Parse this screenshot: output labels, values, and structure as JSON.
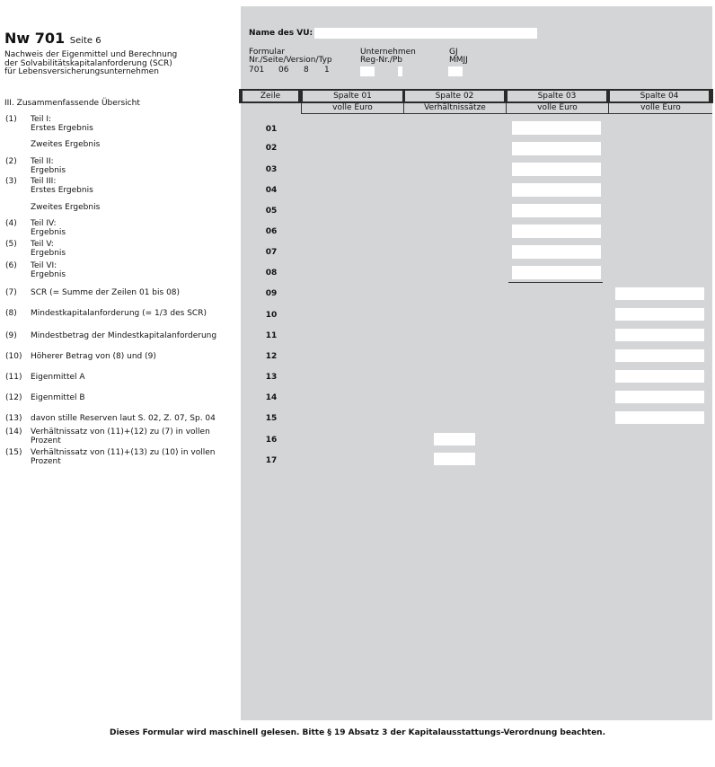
{
  "form_title": "Nw 701",
  "form_title_suffix": "Seite 6",
  "subtitle_lines": [
    "Nachweis der Eigenmittel und Berechnung",
    "der Solvabilitätskapitalanforderung (SCR)",
    "für Lebensversicherungsunternehmen"
  ],
  "section_title": "III. Zusammenfassende Übersicht",
  "name_vu_label": "Name des VU:",
  "meta": {
    "formular_label": "Formular",
    "nr_label": "Nr./Seite/Version/Typ",
    "nr_values": [
      "701",
      "06",
      "8",
      "1"
    ],
    "unternehmen_label": "Unternehmen",
    "regnr_label": "Reg-Nr./Pb",
    "gj_label": "GJ",
    "mmjj_label": "MMJJ"
  },
  "columns": {
    "zeile": "Zeile",
    "headers": [
      "Spalte 01",
      "Spalte 02",
      "Spalte 03",
      "Spalte 04"
    ],
    "units": [
      "volle Euro",
      "Verhältnissätze",
      "volle Euro",
      "volle Euro"
    ]
  },
  "rows": [
    {
      "label_num": "(1)",
      "lines": [
        "Teil I:",
        "Erstes Ergebnis"
      ],
      "zeile": "01"
    },
    {
      "label_num": "",
      "lines": [
        "Zweites Ergebnis"
      ],
      "zeile": "02"
    },
    {
      "label_num": "(2)",
      "lines": [
        "Teil II:",
        "Ergebnis"
      ],
      "zeile": "03"
    },
    {
      "label_num": "(3)",
      "lines": [
        "Teil III:",
        "Erstes Ergebnis"
      ],
      "zeile": "04"
    },
    {
      "label_num": "",
      "lines": [
        "Zweites Ergebnis"
      ],
      "zeile": "05"
    },
    {
      "label_num": "(4)",
      "lines": [
        "Teil IV:",
        "Ergebnis"
      ],
      "zeile": "06"
    },
    {
      "label_num": "(5)",
      "lines": [
        "Teil V:",
        "Ergebnis"
      ],
      "zeile": "07"
    },
    {
      "label_num": "(6)",
      "lines": [
        "Teil VI:",
        "Ergebnis"
      ],
      "zeile": "08"
    },
    {
      "label_num": "(7)",
      "lines": [
        "SCR (= Summe der Zeilen 01 bis 08)"
      ],
      "zeile": "09"
    },
    {
      "label_num": "(8)",
      "lines": [
        "Mindestkapitalanforderung (= 1/3 des SCR)"
      ],
      "zeile": "10"
    },
    {
      "label_num": "(9)",
      "lines": [
        "Mindestbetrag der Mindestkapitalanforderung"
      ],
      "zeile": "11"
    },
    {
      "label_num": "(10)",
      "lines": [
        "Höherer Betrag von (8) und (9)"
      ],
      "zeile": "12"
    },
    {
      "label_num": "(11)",
      "lines": [
        "Eigenmittel A"
      ],
      "zeile": "13"
    },
    {
      "label_num": "(12)",
      "lines": [
        "Eigenmittel B"
      ],
      "zeile": "14"
    },
    {
      "label_num": "(13)",
      "lines": [
        "davon stille Reserven laut S. 02, Z. 07, Sp. 04"
      ],
      "zeile": "15"
    },
    {
      "label_num": "(14)",
      "lines": [
        "Verhältnissatz von (11)+(12) zu (7) in vollen",
        "Prozent"
      ],
      "zeile": "16"
    },
    {
      "label_num": "(15)",
      "lines": [
        "Verhältnissatz von (11)+(13) zu (10) in vollen",
        "Prozent"
      ],
      "zeile": "17"
    }
  ],
  "footer": "Dieses Formular wird maschinell gelesen. Bitte § 19 Absatz 3 der Kapitalausstattungs-Verordnung beachten."
}
